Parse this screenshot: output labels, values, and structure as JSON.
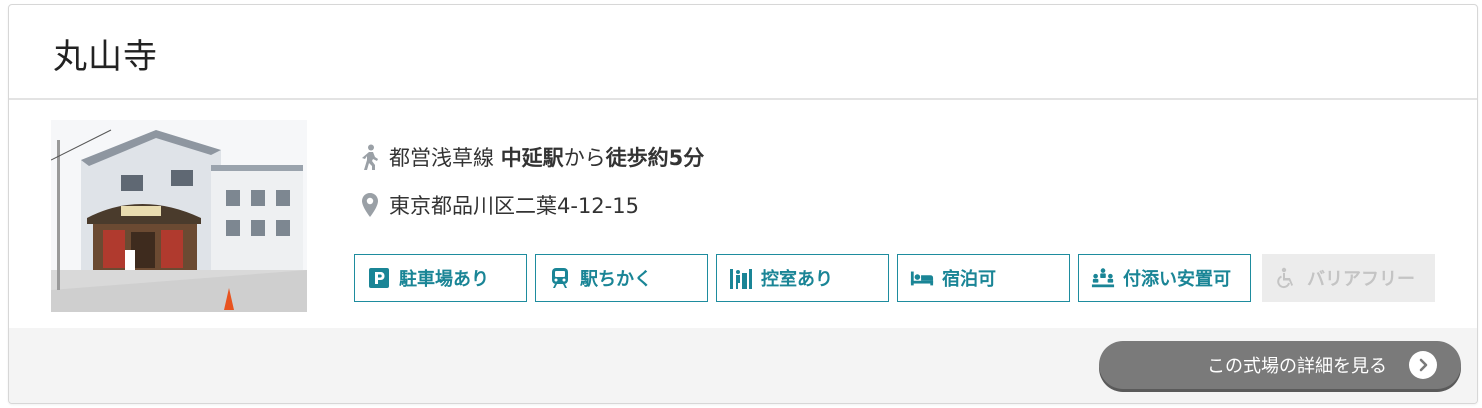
{
  "venue": {
    "name": "丸山寺",
    "photo_alt": "丸山寺 外観"
  },
  "access": {
    "icon": "walking-person-icon",
    "line": "都営浅草線",
    "station": "中延駅",
    "from": "から",
    "walk": "徒歩約5分"
  },
  "address": {
    "icon": "map-pin-icon",
    "text": "東京都品川区二葉4-12-15"
  },
  "facilities": [
    {
      "icon": "parking-icon",
      "label": "駐車場あり",
      "available": true
    },
    {
      "icon": "train-icon",
      "label": "駅ちかく",
      "available": true
    },
    {
      "icon": "waiting-room-icon",
      "label": "控室あり",
      "available": true
    },
    {
      "icon": "bed-icon",
      "label": "宿泊可",
      "available": true
    },
    {
      "icon": "people-icon",
      "label": "付添い安置可",
      "available": true
    },
    {
      "icon": "wheelchair-icon",
      "label": "バリアフリー",
      "available": false
    }
  ],
  "detail_button": {
    "label": "この式場の詳細を見る",
    "icon": "chevron-right-icon"
  },
  "colors": {
    "accent": "#1a8596",
    "button": "#7a7a7a",
    "disabled": "#c4c4c4"
  }
}
